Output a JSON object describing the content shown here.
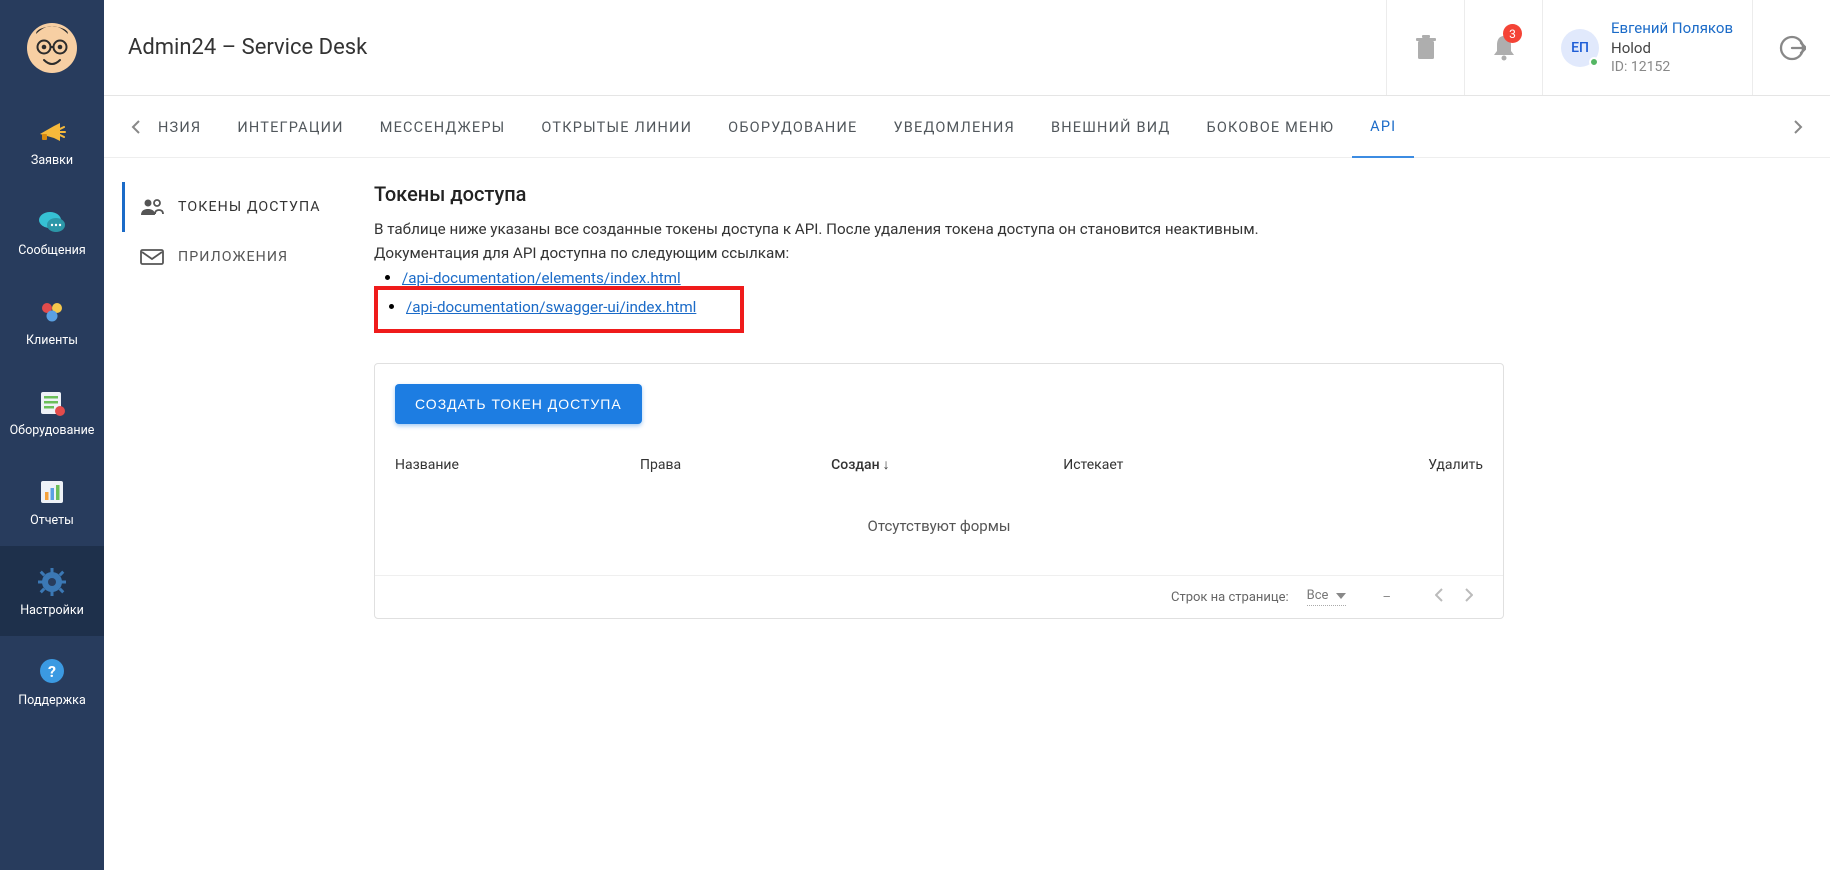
{
  "header": {
    "title": "Admin24 – Service Desk",
    "notif_count": "3",
    "avatar_initials": "ЕП",
    "user_name": "Евгений Поляков",
    "org": "Holod",
    "id_label": "ID: 12152"
  },
  "sidebar": {
    "items": [
      {
        "label": "Заявки"
      },
      {
        "label": "Сообщения"
      },
      {
        "label": "Клиенты"
      },
      {
        "label": "Оборудование"
      },
      {
        "label": "Отчеты"
      },
      {
        "label": "Настройки"
      },
      {
        "label": "Поддержка"
      }
    ]
  },
  "tabs": {
    "partial": "НЗИЯ",
    "items": [
      "ИНТЕГРАЦИИ",
      "МЕССЕНДЖЕРЫ",
      "ОТКРЫТЫЕ ЛИНИИ",
      "ОБОРУДОВАНИЕ",
      "УВЕДОМЛЕНИЯ",
      "ВНЕШНИЙ ВИД",
      "БОКОВОЕ МЕНЮ",
      "API"
    ]
  },
  "subnav": {
    "tokens": "ТОКЕНЫ ДОСТУПА",
    "apps": "ПРИЛОЖЕНИЯ"
  },
  "section": {
    "title": "Токены доступа",
    "desc1": "В таблице ниже указаны все созданные токены доступа к API. После удаления токена доступа он становится неактивным.",
    "desc2": "Документация для API доступна по следующим ссылкам:",
    "link1": "/api-documentation/elements/index.html",
    "link2": "/api-documentation/swagger-ui/index.html",
    "create_btn": "СОЗДАТЬ ТОКЕН ДОСТУПА"
  },
  "table": {
    "col_name": "Название",
    "col_rights": "Права",
    "col_created": "Создан",
    "col_expires": "Истекает",
    "col_delete": "Удалить",
    "empty": "Отсутствуют формы"
  },
  "footer": {
    "rows_label": "Строк на странице:",
    "rows_value": "Все",
    "range": "–"
  }
}
